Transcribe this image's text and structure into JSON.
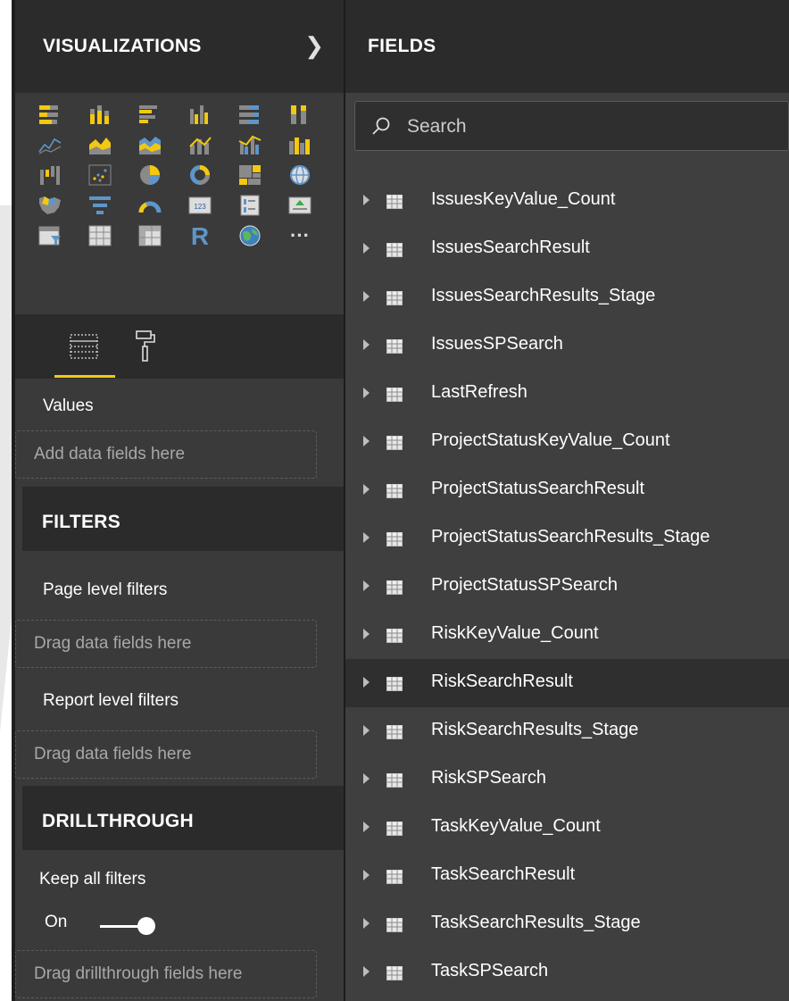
{
  "visualizations": {
    "title": "VISUALIZATIONS",
    "collapse_icon": "chevron-right-icon",
    "icons": [
      "stacked-bar-chart-icon",
      "stacked-column-chart-icon",
      "clustered-bar-chart-icon",
      "clustered-column-chart-icon",
      "100-stacked-bar-chart-icon",
      "100-stacked-column-chart-icon",
      "line-chart-icon",
      "area-chart-icon",
      "stacked-area-chart-icon",
      "line-and-stacked-column-icon",
      "line-and-clustered-column-icon",
      "ribbon-chart-icon",
      "waterfall-chart-icon",
      "scatter-chart-icon",
      "pie-chart-icon",
      "donut-chart-icon",
      "treemap-icon",
      "map-icon",
      "filled-map-icon",
      "funnel-icon",
      "gauge-icon",
      "card-icon",
      "multi-row-card-icon",
      "kpi-icon",
      "slicer-icon",
      "table-icon",
      "matrix-icon",
      "r-visual-icon",
      "arcgis-map-icon",
      "more-visuals-icon"
    ],
    "card_text": "123",
    "r_text": "R",
    "more_text": "···",
    "tabs": [
      {
        "name": "fields-tab-icon"
      },
      {
        "name": "format-tab-icon"
      }
    ],
    "values_label": "Values",
    "values_placeholder": "Add data fields here",
    "filters_header": "FILTERS",
    "page_filters_label": "Page level filters",
    "page_filters_placeholder": "Drag data fields here",
    "report_filters_label": "Report level filters",
    "report_filters_placeholder": "Drag data fields here",
    "drillthrough_header": "DRILLTHROUGH",
    "keep_all_filters_label": "Keep all filters",
    "keep_all_filters_state": "On",
    "drillthrough_placeholder": "Drag drillthrough fields here"
  },
  "fields": {
    "title": "FIELDS",
    "search_placeholder": "Search",
    "items": [
      {
        "label": "IssuesKeyValue_Count"
      },
      {
        "label": "IssuesSearchResult"
      },
      {
        "label": "IssuesSearchResults_Stage"
      },
      {
        "label": "IssuesSPSearch"
      },
      {
        "label": "LastRefresh"
      },
      {
        "label": "ProjectStatusKeyValue_Count"
      },
      {
        "label": "ProjectStatusSearchResult"
      },
      {
        "label": "ProjectStatusSearchResults_Stage"
      },
      {
        "label": "ProjectStatusSPSearch"
      },
      {
        "label": "RiskKeyValue_Count"
      },
      {
        "label": "RiskSearchResult",
        "selected": true
      },
      {
        "label": "RiskSearchResults_Stage"
      },
      {
        "label": "RiskSPSearch"
      },
      {
        "label": "TaskKeyValue_Count"
      },
      {
        "label": "TaskSearchResult"
      },
      {
        "label": "TaskSearchResults_Stage"
      },
      {
        "label": "TaskSPSearch"
      }
    ]
  },
  "colors": {
    "accent": "#f2c811",
    "panel_dark": "#2b2b2b",
    "panel": "#3a3a3a",
    "fields_bg": "#3f3f3f"
  }
}
